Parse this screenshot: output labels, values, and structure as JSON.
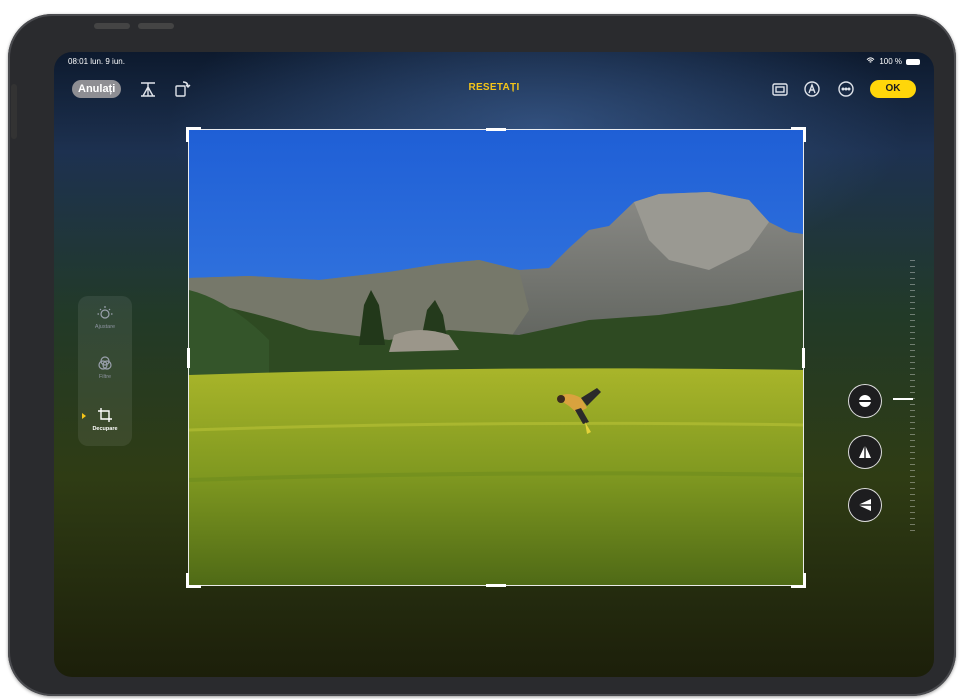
{
  "status": {
    "time": "08:01 lun. 9 iun.",
    "battery": "100 %"
  },
  "toolbar": {
    "cancel_label": "Anulați",
    "reset_label": "RESETAȚI",
    "ok_label": "OK"
  },
  "tools": [
    {
      "label": "Ajustare",
      "icon": "adjust-dial-icon",
      "active": false
    },
    {
      "label": "Filtre",
      "icon": "filters-icon",
      "active": false
    },
    {
      "label": "Decupare",
      "icon": "crop-icon",
      "active": true
    }
  ],
  "right_controls": [
    "straighten-icon",
    "vertical-perspective-icon",
    "horizontal-perspective-icon"
  ],
  "colors": {
    "accent": "#ffd60a",
    "reset": "#f5c518"
  }
}
